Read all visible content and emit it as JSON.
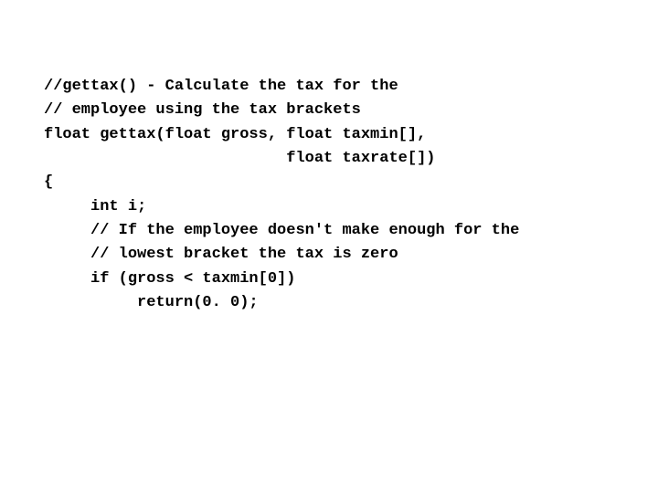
{
  "code": {
    "lines": [
      "//gettax() - Calculate the tax for the",
      "// employee using the tax brackets",
      "float gettax(float gross, float taxmin[],",
      "                          float taxrate[])",
      "{",
      "     int i;",
      "     // If the employee doesn't make enough for the",
      "     // lowest bracket the tax is zero",
      "     if (gross < taxmin[0])",
      "          return(0. 0);"
    ]
  }
}
